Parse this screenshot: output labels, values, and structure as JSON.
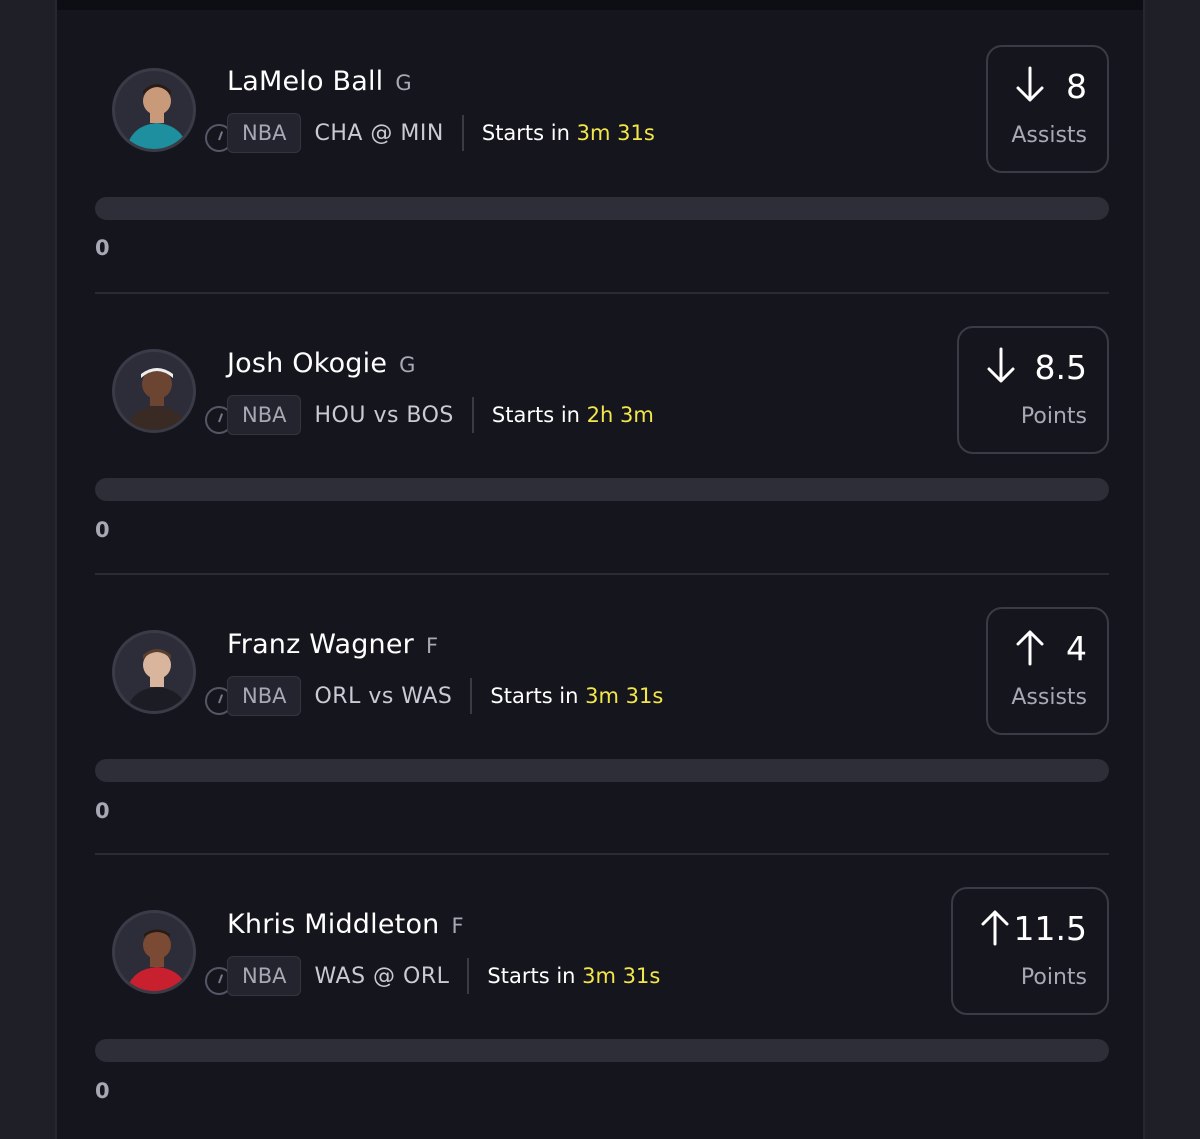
{
  "picks": [
    {
      "name": "LaMelo Ball",
      "position": "G",
      "league": "NBA",
      "matchup": "CHA @ MIN",
      "starts_label": "Starts in",
      "starts_time": "3m 31s",
      "direction": "under",
      "direction_icon": "arrow-down-icon",
      "line": "8",
      "stat": "Assists",
      "progress": 0,
      "current": "0",
      "jersey_color": "#1d8f9f"
    },
    {
      "name": "Josh Okogie",
      "position": "G",
      "league": "NBA",
      "matchup": "HOU vs BOS",
      "starts_label": "Starts in",
      "starts_time": "2h 3m",
      "direction": "under",
      "direction_icon": "arrow-down-icon",
      "line": "8.5",
      "stat": "Points",
      "progress": 0,
      "current": "0",
      "jersey_color": "#3a2a24"
    },
    {
      "name": "Franz Wagner",
      "position": "F",
      "league": "NBA",
      "matchup": "ORL vs WAS",
      "starts_label": "Starts in",
      "starts_time": "3m 31s",
      "direction": "over",
      "direction_icon": "arrow-up-icon",
      "line": "4",
      "stat": "Assists",
      "progress": 0,
      "current": "0",
      "jersey_color": "#1c1d24"
    },
    {
      "name": "Khris Middleton",
      "position": "F",
      "league": "NBA",
      "matchup": "WAS @ ORL",
      "starts_label": "Starts in",
      "starts_time": "3m 31s",
      "direction": "over",
      "direction_icon": "arrow-up-icon",
      "line": "11.5",
      "stat": "Points",
      "progress": 0,
      "current": "0",
      "jersey_color": "#c8202f"
    }
  ],
  "colors": {
    "background": "#15161d",
    "accent_time": "#f4e64a",
    "muted_text": "#a8a9b5",
    "progress_track": "#2d2e38"
  }
}
